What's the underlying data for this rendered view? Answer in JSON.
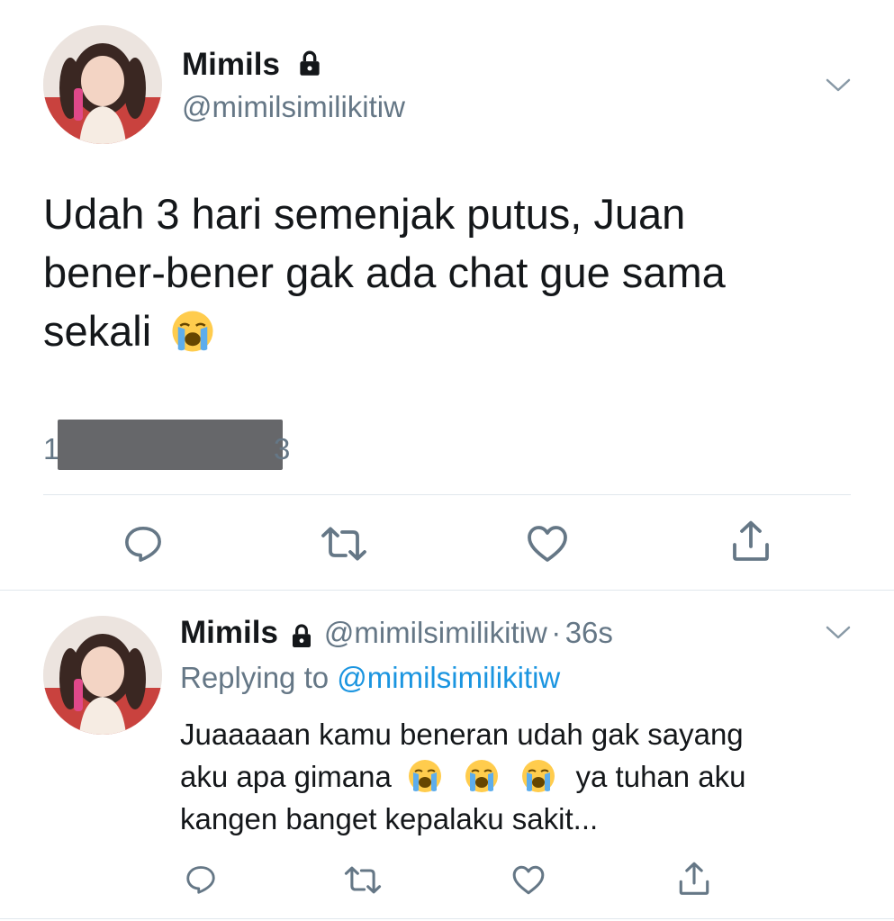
{
  "main_tweet": {
    "author_name": "Mimils",
    "author_handle": "@mimilsimilikitiw",
    "text_lines": [
      "Udah 3 hari semenjak putus, Juan",
      "bener-bener gak ada chat gue sama",
      "sekali"
    ],
    "emoji": "loudly-crying-face",
    "timestamp_visible_start": "1",
    "timestamp_visible_end": "3"
  },
  "reply_tweet": {
    "author_name": "Mimils",
    "author_handle": "@mimilsimilikitiw",
    "separator": "·",
    "age": "36s",
    "replying_label": "Replying to",
    "replying_handle": "@mimilsimilikitiw",
    "line1": "Juaaaaan kamu beneran udah gak sayang",
    "line2_start": "aku apa gimana",
    "line2_end": "ya tuhan aku",
    "line3": "kangen banget kepalaku sakit..."
  },
  "icons": [
    "lock-icon",
    "chevron-down-icon",
    "reply-icon",
    "retweet-icon",
    "like-icon",
    "share-icon",
    "loudly-crying-face-emoji"
  ],
  "colors": {
    "text": "#14171a",
    "muted": "#657786",
    "link": "#1b95e0",
    "divider": "#e1e8ed"
  }
}
